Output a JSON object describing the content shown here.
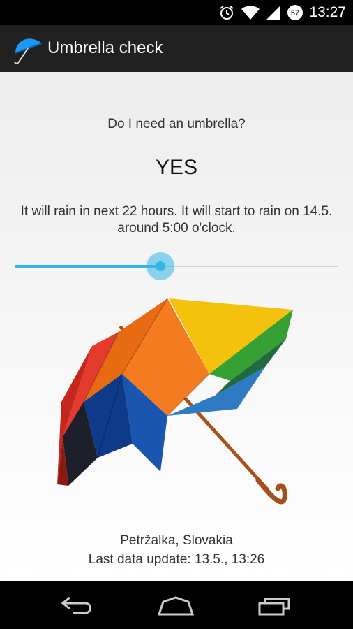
{
  "status_bar": {
    "time": "13:27",
    "battery_level": "57",
    "icons": [
      "alarm-icon",
      "wifi-icon",
      "signal-icon",
      "battery-icon"
    ]
  },
  "app_bar": {
    "title": "Umbrella check",
    "icon": "umbrella-app-icon"
  },
  "main": {
    "question": "Do I need an umbrella?",
    "answer": "YES",
    "forecast": "It will rain in next 22 hours. It will start to rain on 14.5. around 5:00 o'clock.",
    "slider_value_fraction": 0.45,
    "image": "rainbow-umbrella-image",
    "location": "Petržalka, Slovakia",
    "last_update": "Last data update: 13.5., 13:26"
  },
  "nav_bar": {
    "buttons": [
      "back-icon",
      "home-icon",
      "recent-apps-icon"
    ]
  },
  "colors": {
    "accent": "#33b5e5",
    "action_bar": "#212121"
  }
}
